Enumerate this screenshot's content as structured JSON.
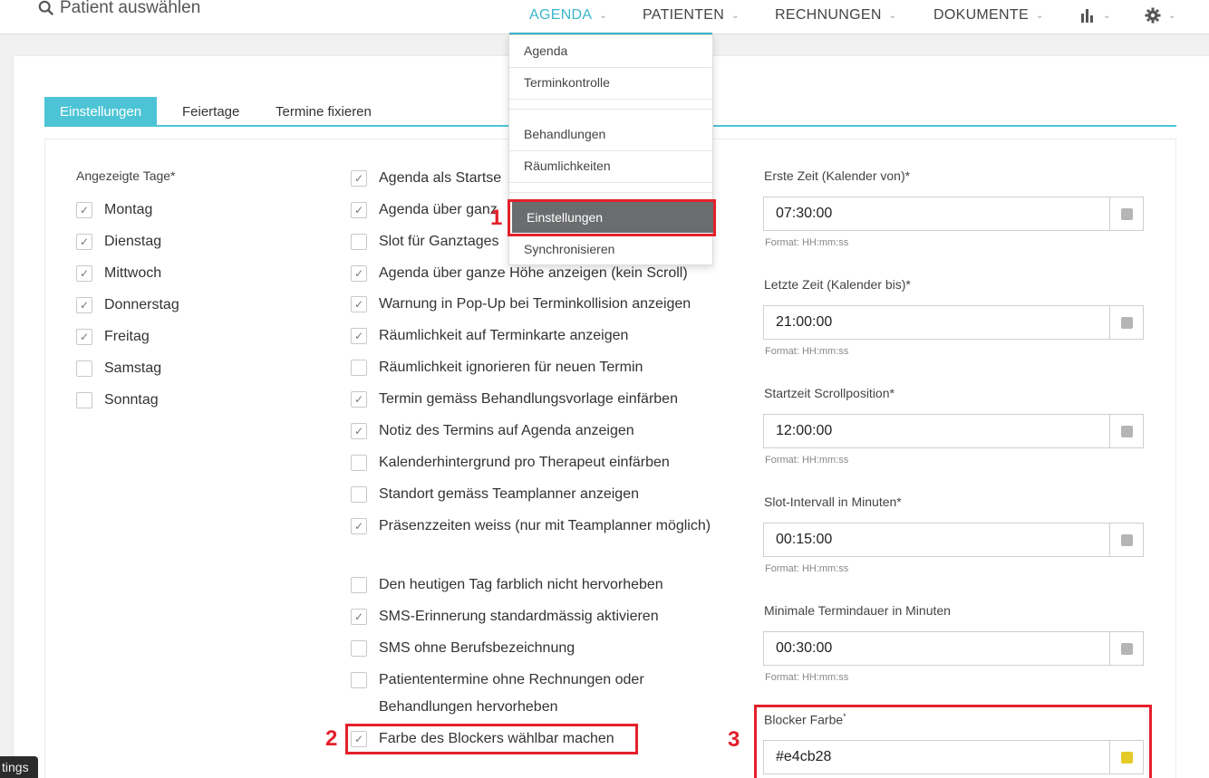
{
  "topbar": {
    "search_text": "Patient auswählen",
    "nav": [
      {
        "label": "AGENDA"
      },
      {
        "label": "PATIENTEN"
      },
      {
        "label": "RECHNUNGEN"
      },
      {
        "label": "DOKUMENTE"
      }
    ]
  },
  "dropdown": {
    "items": [
      {
        "label": "Agenda"
      },
      {
        "label": "Terminkontrolle"
      },
      {
        "label": "Behandlungen"
      },
      {
        "label": "Räumlichkeiten"
      },
      {
        "label": "Einstellungen"
      },
      {
        "label": "Synchronisieren"
      }
    ]
  },
  "tabs": [
    {
      "label": "Einstellungen"
    },
    {
      "label": "Feiertage"
    },
    {
      "label": "Termine fixieren"
    }
  ],
  "days": {
    "label": "Angezeigte Tage*",
    "items": [
      {
        "label": "Montag",
        "checked": true
      },
      {
        "label": "Dienstag",
        "checked": true
      },
      {
        "label": "Mittwoch",
        "checked": true
      },
      {
        "label": "Donnerstag",
        "checked": true
      },
      {
        "label": "Freitag",
        "checked": true
      },
      {
        "label": "Samstag",
        "checked": false
      },
      {
        "label": "Sonntag",
        "checked": false
      }
    ]
  },
  "options": [
    {
      "label": "Agenda als Startse",
      "checked": true
    },
    {
      "label": "Agenda über ganz",
      "checked": true
    },
    {
      "label": "Slot für Ganztages",
      "checked": false
    },
    {
      "label": "Agenda über ganze Höhe anzeigen (kein Scroll)",
      "checked": true
    },
    {
      "label": "Warnung in Pop-Up bei Terminkollision anzeigen",
      "checked": true
    },
    {
      "label": "Räumlichkeit auf Terminkarte anzeigen",
      "checked": true
    },
    {
      "label": "Räumlichkeit ignorieren für neuen Termin",
      "checked": false
    },
    {
      "label": "Termin gemäss Behandlungsvorlage einfärben",
      "checked": true
    },
    {
      "label": "Notiz des Termins auf Agenda anzeigen",
      "checked": true
    },
    {
      "label": "Kalenderhintergrund pro Therapeut einfärben",
      "checked": false
    },
    {
      "label": "Standort gemäss Teamplanner anzeigen",
      "checked": false
    },
    {
      "label": "Präsenzzeiten weiss (nur mit Teamplanner möglich)",
      "checked": true
    },
    {
      "label": "Den heutigen Tag farblich nicht hervorheben",
      "checked": false
    },
    {
      "label": "SMS-Erinnerung standardmässig aktivieren",
      "checked": true
    },
    {
      "label": "SMS ohne Berufsbezeichnung",
      "checked": false
    },
    {
      "label": "Patiententermine ohne Rechnungen oder Behandlungen hervorheben",
      "checked": false
    },
    {
      "label": "Farbe des Blockers wählbar machen",
      "checked": true
    }
  ],
  "fields": [
    {
      "label": "Erste Zeit (Kalender von)*",
      "value": "07:30:00",
      "hint": "Format: HH:mm:ss"
    },
    {
      "label": "Letzte Zeit (Kalender bis)*",
      "value": "21:00:00",
      "hint": "Format: HH:mm:ss"
    },
    {
      "label": "Startzeit Scrollposition*",
      "value": "12:00:00",
      "hint": "Format: HH:mm:ss"
    },
    {
      "label": "Slot-Intervall in Minuten*",
      "value": "00:15:00",
      "hint": "Format: HH:mm:ss"
    },
    {
      "label": "Minimale Termindauer in Minuten",
      "value": "00:30:00",
      "hint": "Format: HH:mm:ss"
    }
  ],
  "blocker": {
    "label": "Blocker Farbe",
    "required_mark": "*",
    "value": "#e4cb28",
    "swatch_color": "#e4cb28"
  },
  "annotations": {
    "one": "1",
    "two": "2",
    "three": "3"
  },
  "tooltip": "tings",
  "colors": {
    "accent": "#4dc4d6",
    "highlight": "#e3202b",
    "field_swatch": "#b5b5b5"
  }
}
